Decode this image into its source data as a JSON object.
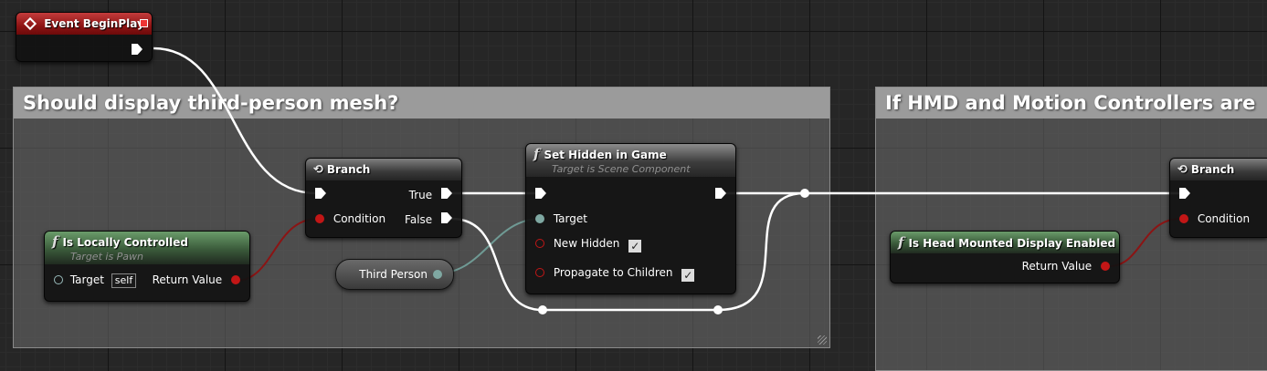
{
  "comments": [
    {
      "title": "Should display third-person mesh?"
    },
    {
      "title": "If HMD and Motion Controllers are"
    }
  ],
  "nodes": {
    "event_begin_play": {
      "title": "Event BeginPlay"
    },
    "is_locally_controlled": {
      "title": "Is Locally Controlled",
      "subtitle": "Target is Pawn",
      "target_label": "Target",
      "target_value": "self",
      "return_label": "Return Value"
    },
    "branch_1": {
      "title": "Branch",
      "condition_label": "Condition",
      "true_label": "True",
      "false_label": "False"
    },
    "third_person": {
      "label": "Third Person"
    },
    "set_hidden": {
      "title": "Set Hidden in Game",
      "subtitle": "Target is Scene Component",
      "target_label": "Target",
      "new_hidden_label": "New Hidden",
      "propagate_label": "Propagate to Children"
    },
    "hmd_enabled": {
      "title": "Is Head Mounted Display Enabled",
      "return_label": "Return Value"
    },
    "branch_2": {
      "title": "Branch",
      "condition_label": "Condition"
    }
  },
  "icons": {
    "function": "f",
    "branch": "branch-icon",
    "event": "event-diamond-icon",
    "check": "✓"
  },
  "colors": {
    "exec_wire": "#ffffff",
    "bool_wire": "#8b1414",
    "object_wire": "#6f9a94",
    "event_header": "#a31c1c"
  }
}
